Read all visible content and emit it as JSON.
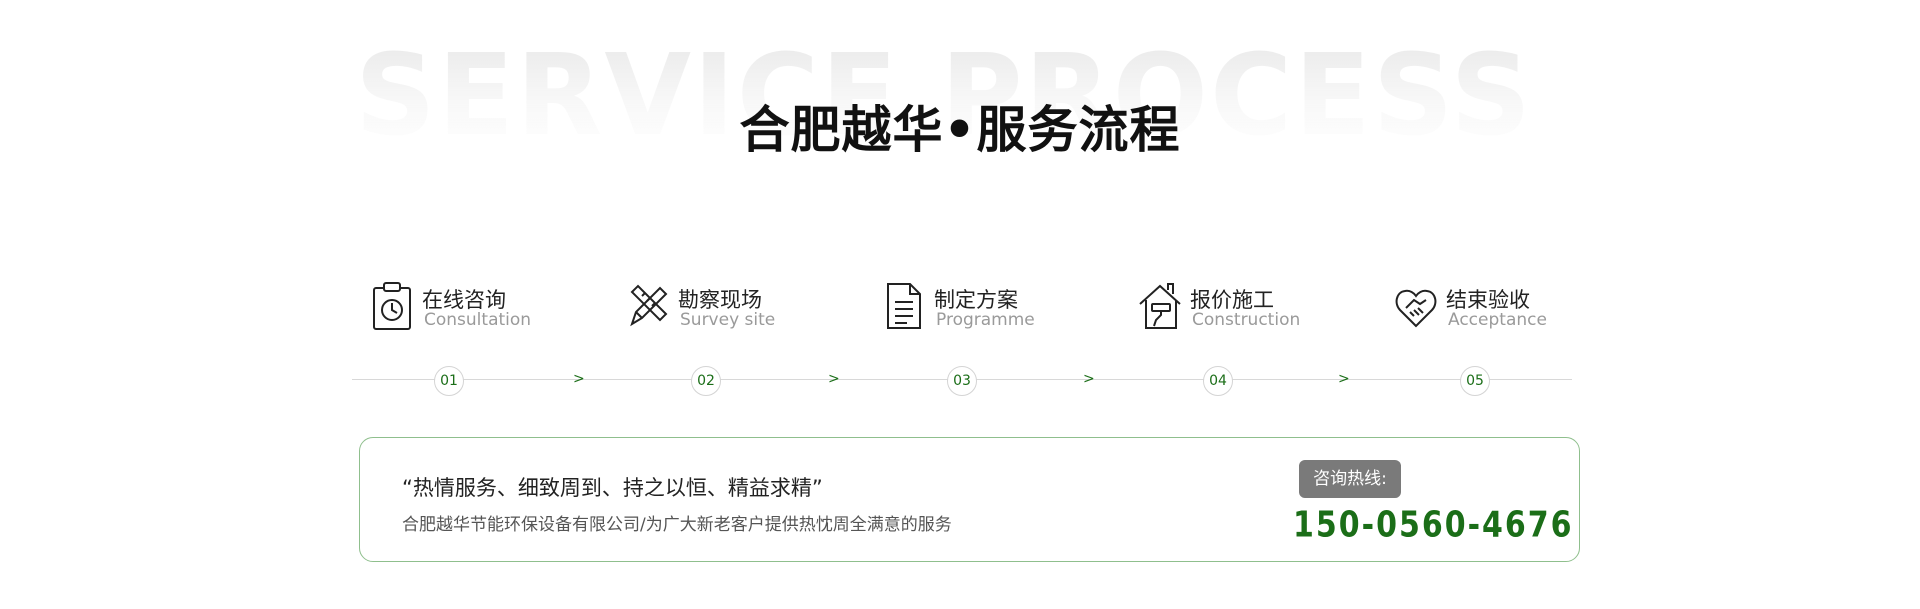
{
  "heading": {
    "background_word": "SERVICE PROCESS",
    "title": "合肥越华•服务流程"
  },
  "steps": [
    {
      "cn": "在线咨询",
      "en": "Consultation",
      "icon": "clipboard-clock-icon",
      "number": "01"
    },
    {
      "cn": "勘察现场",
      "en": "Survey site",
      "icon": "pencil-ruler-icon",
      "number": "02"
    },
    {
      "cn": "制定方案",
      "en": "Programme",
      "icon": "document-icon",
      "number": "03"
    },
    {
      "cn": "报价施工",
      "en": "Construction",
      "icon": "house-paint-roller-icon",
      "number": "04"
    },
    {
      "cn": "结束验收",
      "en": "Acceptance",
      "icon": "heart-handshake-icon",
      "number": "05"
    }
  ],
  "arrow_glyph": ">",
  "contact": {
    "slogan": "“热情服务、细致周到、持之以恒、精益求精”",
    "description": "合肥越华节能环保设备有限公司/为广大新老客户提供热忱周全满意的服务",
    "hotline_label": "咨询热线:",
    "phone": "150-0560-4676"
  },
  "colors": {
    "accent_green": "#1b6e18",
    "box_border": "#8fbf8d",
    "label_bg": "#7a7a7a",
    "timeline": "#d8d8d8"
  }
}
